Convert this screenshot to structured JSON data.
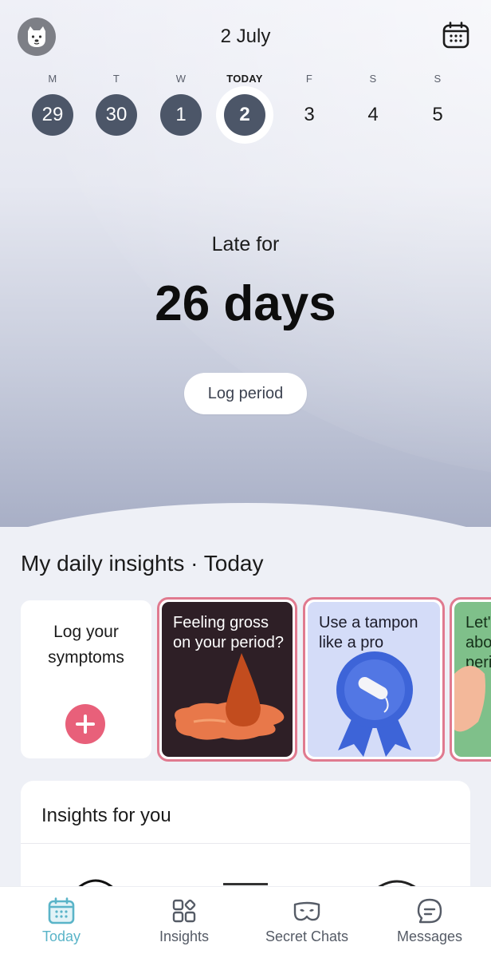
{
  "header": {
    "date_title": "2 July"
  },
  "week": [
    {
      "dow": "M",
      "num": "29",
      "state": "past"
    },
    {
      "dow": "T",
      "num": "30",
      "state": "past"
    },
    {
      "dow": "W",
      "num": "1",
      "state": "past"
    },
    {
      "dow": "TODAY",
      "num": "2",
      "state": "today"
    },
    {
      "dow": "F",
      "num": "3",
      "state": "future"
    },
    {
      "dow": "S",
      "num": "4",
      "state": "future"
    },
    {
      "dow": "S",
      "num": "5",
      "state": "future"
    }
  ],
  "status": {
    "label": "Late for",
    "value": "26 days",
    "button": "Log period"
  },
  "daily_insights": {
    "title": "My daily insights · Today",
    "log_card": {
      "line1": "Log your",
      "line2": "symptoms"
    },
    "stories": [
      {
        "title": "Feeling gross on your period?",
        "icon": "drop-illustration"
      },
      {
        "title": "Use a tampon like a pro",
        "icon": "ribbon-tampon-illustration"
      },
      {
        "title": "Let's talk about periods",
        "icon": "hand-illustration"
      }
    ]
  },
  "insights_for_you": {
    "title": "Insights for you"
  },
  "bottom_nav": [
    {
      "label": "Today",
      "icon": "calendar-icon",
      "active": true
    },
    {
      "label": "Insights",
      "icon": "grid-icon",
      "active": false
    },
    {
      "label": "Secret Chats",
      "icon": "mask-icon",
      "active": false
    },
    {
      "label": "Messages",
      "icon": "chat-icon",
      "active": false
    }
  ],
  "colors": {
    "accent": "#5ab4c8",
    "day_circle": "#4c5668",
    "log_plus": "#e8607a",
    "story_border": "#e07a8f"
  }
}
